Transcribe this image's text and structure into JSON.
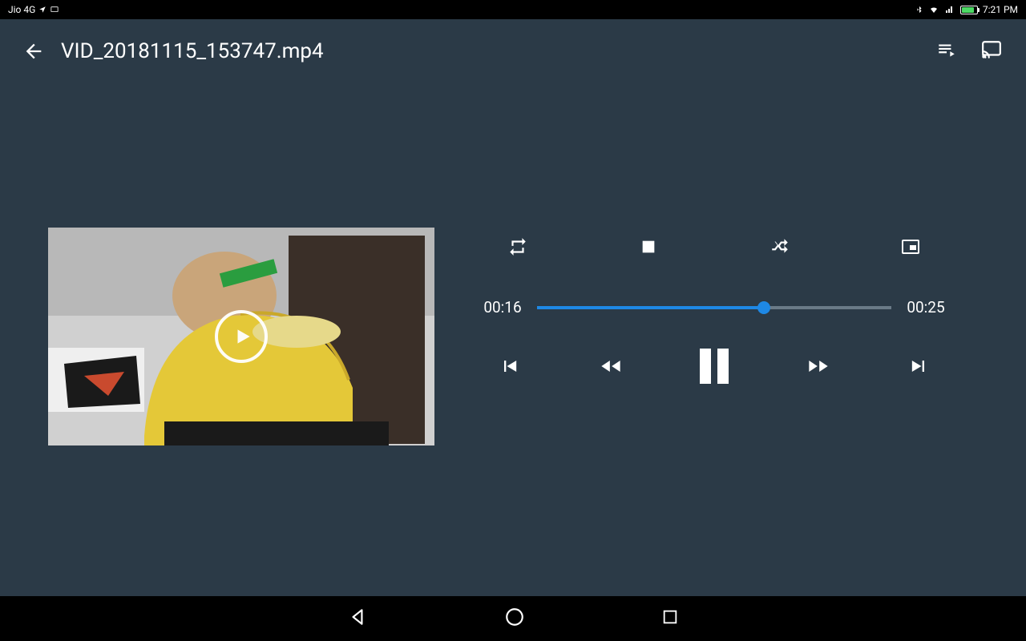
{
  "status": {
    "carrier": "Jio 4G",
    "time": "7:21 PM"
  },
  "header": {
    "title": "VID_20181115_153747.mp4"
  },
  "playback": {
    "current_time": "00:16",
    "total_time": "00:25",
    "progress_percent": 64
  },
  "icons": {
    "back": "back-arrow",
    "queue": "queue",
    "cast": "cast",
    "repeat": "repeat",
    "stop": "stop",
    "shuffle": "shuffle",
    "pip": "picture-in-picture",
    "prev": "skip-previous",
    "rewind": "rewind",
    "pause": "pause",
    "forward": "fast-forward",
    "next": "skip-next",
    "play_overlay": "play",
    "nav_back": "nav-back",
    "nav_home": "nav-home",
    "nav_recent": "nav-recent"
  }
}
